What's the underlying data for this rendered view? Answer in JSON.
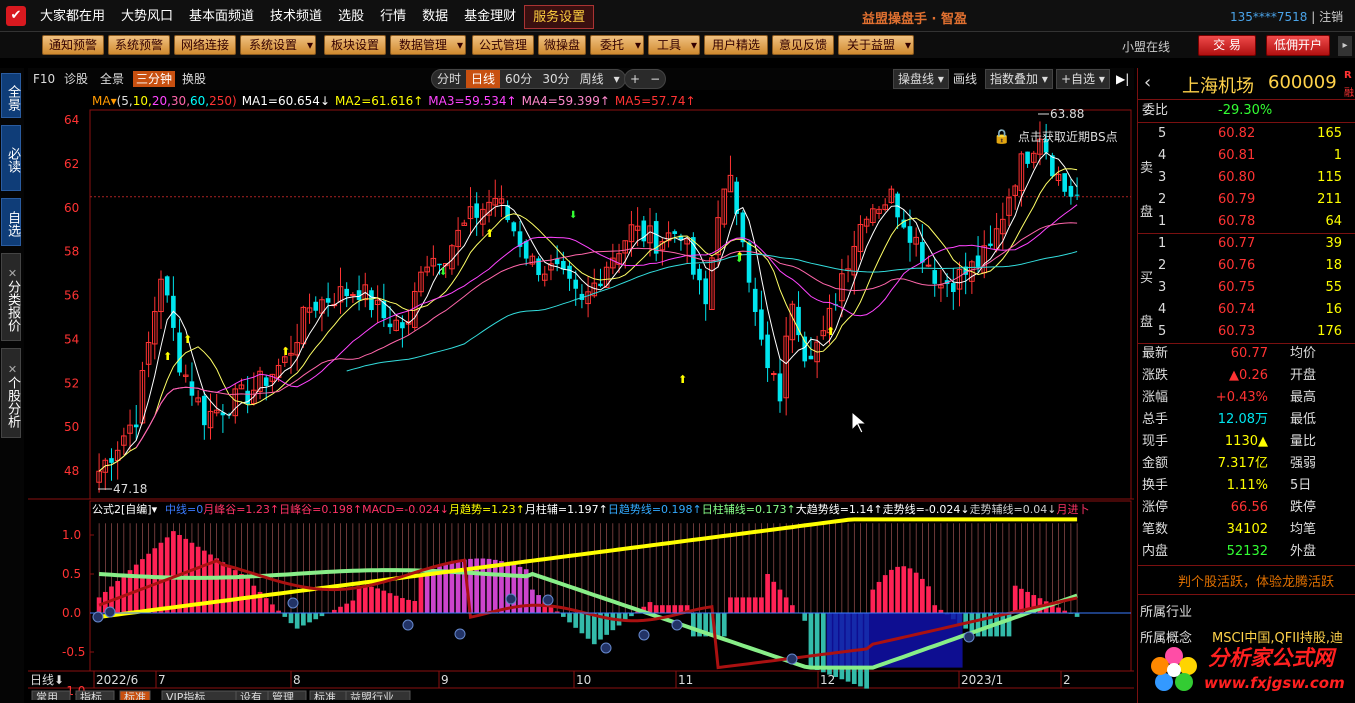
{
  "app": {
    "logo": "✔",
    "brand": "益盟操盘手 · 智盈",
    "user_phone": "135****7518",
    "logout": "注销",
    "online": "小盟在线",
    "trade_btn": "交 易",
    "open_btn": "低佣开户"
  },
  "menu": [
    "大家都在用",
    "大势风口",
    "基本面频道",
    "技术频道",
    "选股",
    "行情",
    "数据",
    "基金理财",
    "服务设置"
  ],
  "toolbar": [
    "通知预警",
    "系统预警",
    "网络连接",
    "系统设置",
    "板块设置",
    "数据管理",
    "公式管理",
    "微操盘",
    "委托",
    "工具",
    "用户精选",
    "意见反馈",
    "关于益盟"
  ],
  "sidebar": [
    "全景",
    "必读",
    "自选",
    "分类报价",
    "个股分析"
  ],
  "ctrl": {
    "f10": "F10",
    "diag": "诊股",
    "full": "全景",
    "three": "三分钟",
    "switch": "换股",
    "periods": [
      "分时",
      "日线",
      "60分",
      "30分",
      "周线"
    ],
    "plus": "+",
    "minus": "−",
    "op_line": "操盘线",
    "draw": "画线",
    "overlay": "指数叠加",
    "add_fav": "+自选",
    "next": "▶|"
  },
  "ma": {
    "tag": "MA▾",
    "params_pre": "(5,",
    "p10": "10,",
    "p20": "20,",
    "p30": "30,",
    "p60": "60,",
    "p250": "250)",
    "ma1": "MA1=60.654↓",
    "ma2": "MA2=61.616↑",
    "ma3": "MA3=59.534↑",
    "ma4": "MA4=59.399↑",
    "ma5": "MA5=57.74↑",
    "colors": {
      "ma1": "#ffffff",
      "ma2": "#ffff00",
      "ma3": "#ff44ff",
      "ma4": "#ff66aa",
      "ma5": "#ff3333",
      "up": "#ff3333",
      "down": "#00e5ee"
    }
  },
  "price_axis": [
    "64",
    "62",
    "60",
    "58",
    "56",
    "54",
    "52",
    "50",
    "48"
  ],
  "annotations": {
    "high": "63.88",
    "low": "47.18",
    "bs_hint": "点击获取近期BS点"
  },
  "indicator": {
    "name": "公式2[自编]▾",
    "values": [
      {
        "text": "中线=0",
        "color": "#3a7bff"
      },
      {
        "text": "月峰谷=1.23↑",
        "color": "#ff3366"
      },
      {
        "text": "日峰谷=0.198↑",
        "color": "#ff3366"
      },
      {
        "text": "MACD=-0.024↓",
        "color": "#ff3366"
      },
      {
        "text": "月趋势=1.23↑",
        "color": "#ffff00"
      },
      {
        "text": "月柱辅=1.197↑",
        "color": "#ffffff"
      },
      {
        "text": "日趋势线=0.198↑",
        "color": "#33aaff"
      },
      {
        "text": "日柱辅线=0.173↑",
        "color": "#88ff88"
      },
      {
        "text": "大趋势线=1.14↑",
        "color": "#ffffff"
      },
      {
        "text": "走势线=-0.024↓",
        "color": "#ffffff"
      },
      {
        "text": "走势辅线=0.04↓",
        "color": "#cccccc"
      },
      {
        "text": "月进卜",
        "color": "#ff3366"
      }
    ],
    "axis": [
      "1.0",
      "0.5",
      "0.0",
      "-0.5",
      "-1.0"
    ]
  },
  "dates": [
    "2022/6",
    "7",
    "8",
    "9",
    "10",
    "11",
    "12",
    "2023/1",
    "2"
  ],
  "bottom_tabs": {
    "period": "日线⬇",
    "tabs": [
      "常用",
      "指标",
      "标准",
      "VIP指标",
      "设有",
      "管理",
      "标准",
      "益盟行业"
    ]
  },
  "stock": {
    "name": "上海机场",
    "code": "600009",
    "badge": "R",
    "badge2": "融"
  },
  "weibi": {
    "label": "委比",
    "value": "-29.30%"
  },
  "sell": [
    {
      "n": "5",
      "p": "60.82",
      "v": "165"
    },
    {
      "n": "4",
      "p": "60.81",
      "v": "1"
    },
    {
      "n": "3",
      "p": "60.80",
      "v": "115"
    },
    {
      "n": "2",
      "p": "60.79",
      "v": "211"
    },
    {
      "n": "1",
      "p": "60.78",
      "v": "64"
    }
  ],
  "buy": [
    {
      "n": "1",
      "p": "60.77",
      "v": "39"
    },
    {
      "n": "2",
      "p": "60.76",
      "v": "18"
    },
    {
      "n": "3",
      "p": "60.75",
      "v": "55"
    },
    {
      "n": "4",
      "p": "60.74",
      "v": "16"
    },
    {
      "n": "5",
      "p": "60.73",
      "v": "176"
    }
  ],
  "sell_tag": [
    "卖",
    "盘"
  ],
  "buy_tag": [
    "买",
    "盘"
  ],
  "quotes": [
    {
      "l": "最新",
      "v": "60.77",
      "c": "#ff3333",
      "r": "均价"
    },
    {
      "l": "涨跌",
      "v": "▲0.26",
      "c": "#ff3333",
      "r": "开盘"
    },
    {
      "l": "涨幅",
      "v": "+0.43%",
      "c": "#ff3333",
      "r": "最高"
    },
    {
      "l": "总手",
      "v": "12.08万",
      "c": "#00e5ee",
      "r": "最低"
    },
    {
      "l": "现手",
      "v": "1130▲",
      "c": "#ffff00",
      "r": "量比"
    },
    {
      "l": "金额",
      "v": "7.317亿",
      "c": "#ffff00",
      "r": "强弱"
    },
    {
      "l": "换手",
      "v": "1.11%",
      "c": "#ffff00",
      "r": "5日"
    },
    {
      "l": "涨停",
      "v": "66.56",
      "c": "#ff3333",
      "r": "跌停"
    },
    {
      "l": "笔数",
      "v": "34102",
      "c": "#ffff00",
      "r": "均笔"
    },
    {
      "l": "内盘",
      "v": "52132",
      "c": "#33ff33",
      "r": "外盘"
    }
  ],
  "promo": "判个股活跃，体验龙腾活跃",
  "industry": {
    "label": "所属行业",
    "concept_label": "所属概念",
    "concept": "MSCI中国,QFII持股,迪"
  },
  "watermark": {
    "t1": "分析家公式网",
    "t2": "www.fxjgsw.com"
  }
}
